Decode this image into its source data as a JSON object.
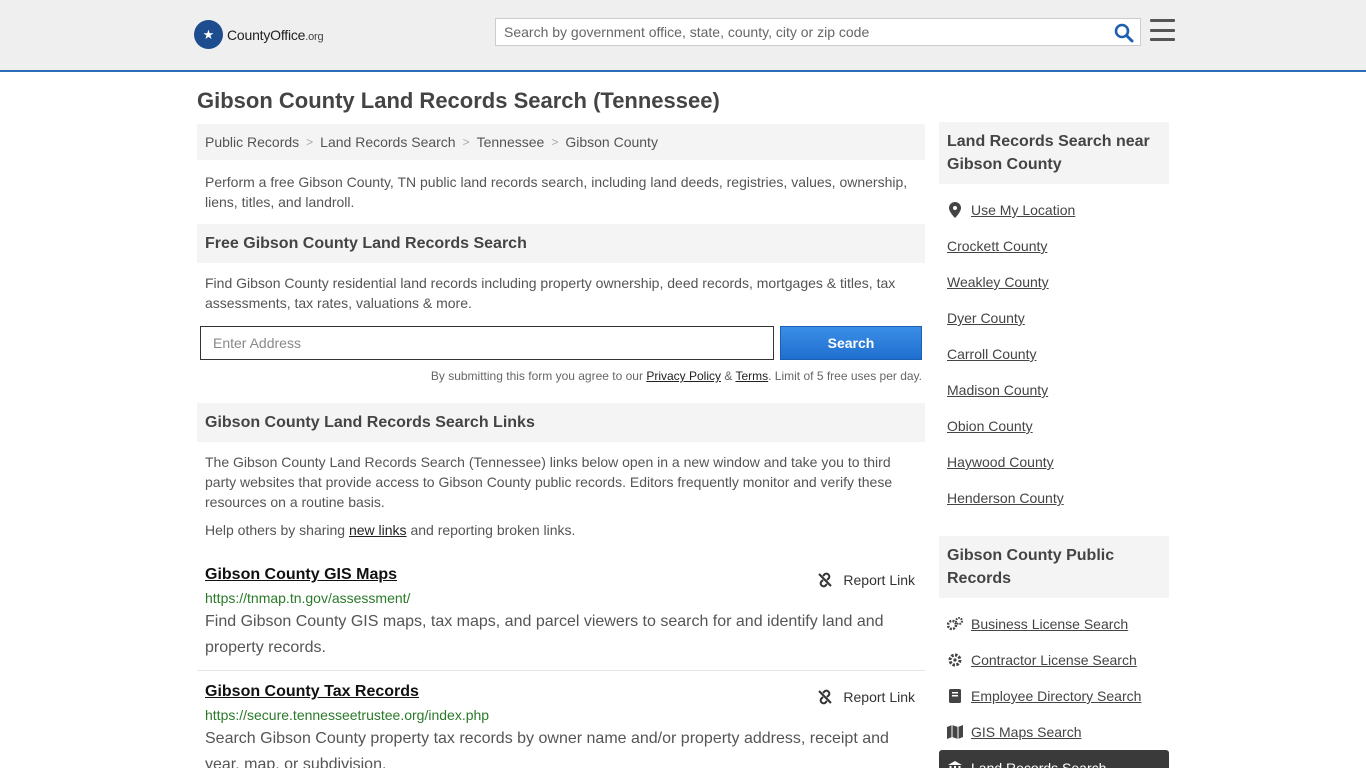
{
  "header": {
    "logo_main": "CountyOffice",
    "logo_suffix": ".org",
    "search_placeholder": "Search by government office, state, county, city or zip code"
  },
  "page_title": "Gibson County Land Records Search (Tennessee)",
  "breadcrumb": [
    "Public Records",
    "Land Records Search",
    "Tennessee",
    "Gibson County"
  ],
  "intro": "Perform a free Gibson County, TN public land records search, including land deeds, registries, values, ownership, liens, titles, and landroll.",
  "free_search": {
    "heading": "Free Gibson County Land Records Search",
    "text": "Find Gibson County residential land records including property ownership, deed records, mortgages & titles, tax assessments, tax rates, valuations & more.",
    "address_placeholder": "Enter Address",
    "button": "Search",
    "terms_prefix": "By submitting this form you agree to our ",
    "privacy": "Privacy Policy",
    "amp": " & ",
    "terms": "Terms",
    "terms_suffix": ". Limit of 5 free uses per day."
  },
  "links_section": {
    "heading": "Gibson County Land Records Search Links",
    "text": "The Gibson County Land Records Search (Tennessee) links below open in a new window and take you to third party websites that provide access to Gibson County public records. Editors frequently monitor and verify these resources on a routine basis.",
    "help_prefix": "Help others by sharing ",
    "help_link": "new links",
    "help_suffix": " and reporting broken links.",
    "report_label": "Report Link",
    "items": [
      {
        "title": "Gibson County GIS Maps",
        "url": "https://tnmap.tn.gov/assessment/",
        "desc": "Find Gibson County GIS maps, tax maps, and parcel viewers to search for and identify land and property records."
      },
      {
        "title": "Gibson County Tax Records",
        "url": "https://secure.tennesseetrustee.org/index.php",
        "desc": "Search Gibson County property tax records by owner name and/or property address, receipt and year, map, or subdivision."
      }
    ]
  },
  "sidebar": {
    "near_heading": "Land Records Search near Gibson County",
    "use_location": "Use My Location",
    "counties": [
      "Crockett County",
      "Weakley County",
      "Dyer County",
      "Carroll County",
      "Madison County",
      "Obion County",
      "Haywood County",
      "Henderson County"
    ],
    "public_heading": "Gibson County Public Records",
    "public_items": [
      {
        "label": "Business License Search",
        "icon": "gears-icon"
      },
      {
        "label": "Contractor License Search",
        "icon": "gear-icon"
      },
      {
        "label": "Employee Directory Search",
        "icon": "book-icon"
      },
      {
        "label": "GIS Maps Search",
        "icon": "map-icon"
      },
      {
        "label": "Land Records Search",
        "icon": "landmark-icon"
      }
    ]
  }
}
